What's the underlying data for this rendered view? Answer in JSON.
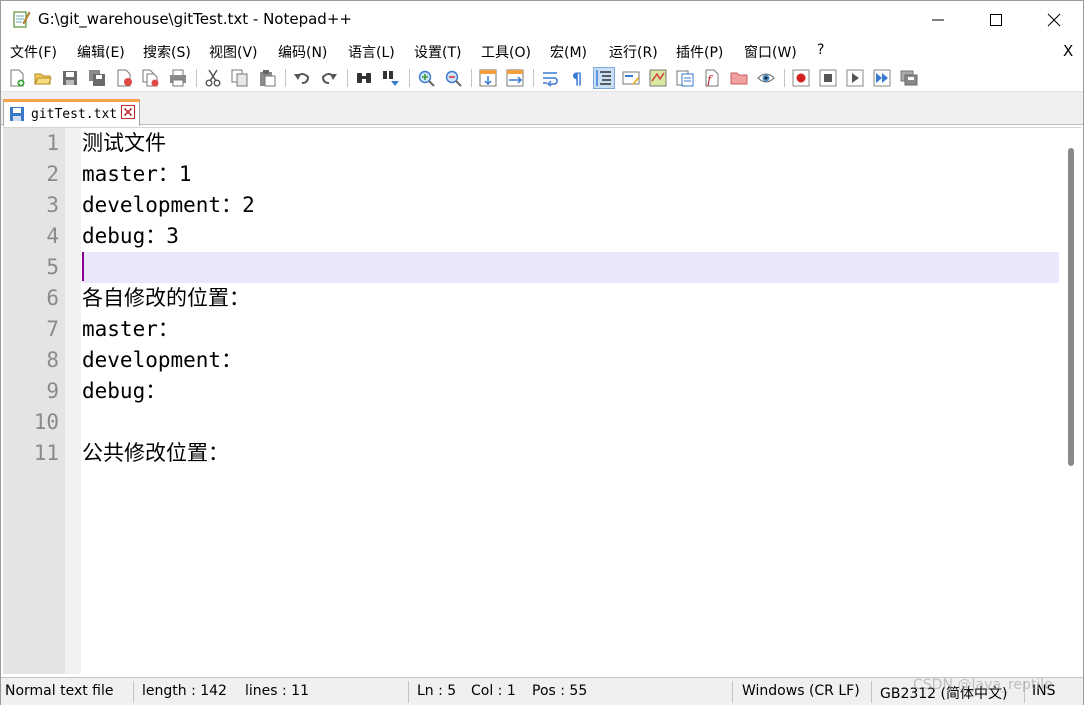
{
  "window": {
    "title": "G:\\git_warehouse\\gitTest.txt - Notepad++"
  },
  "menubar": {
    "items": [
      "文件(F)",
      "编辑(E)",
      "搜索(S)",
      "视图(V)",
      "编码(N)",
      "语言(L)",
      "设置(T)",
      "工具(O)",
      "宏(M)",
      "运行(R)",
      "插件(P)",
      "窗口(W)",
      "?"
    ],
    "close_label": "X"
  },
  "toolbar": {
    "icons": [
      "new-file-icon",
      "open-file-icon",
      "save-icon",
      "save-all-icon",
      "close-icon",
      "close-all-icon",
      "print-icon",
      "cut-icon",
      "copy-icon",
      "paste-icon",
      "undo-icon",
      "redo-icon",
      "find-icon",
      "replace-icon",
      "zoom-in-icon",
      "zoom-out-icon",
      "sync-vertical-icon",
      "sync-horizontal-icon",
      "word-wrap-icon",
      "show-all-chars-icon",
      "indent-guide-icon",
      "user-define-lang-icon",
      "doc-map-icon",
      "function-list-icon",
      "folder-as-workspace-icon",
      "monitoring-icon",
      "record-macro-icon",
      "stop-record-icon",
      "play-macro-icon",
      "run-macro-multiple-icon",
      "save-macro-icon"
    ]
  },
  "tabs": [
    {
      "label": "gitTest.txt"
    }
  ],
  "editor": {
    "lines": [
      {
        "num": "1",
        "text": "测试文件"
      },
      {
        "num": "2",
        "text": "master：1"
      },
      {
        "num": "3",
        "text": "development：2"
      },
      {
        "num": "4",
        "text": "debug：3"
      },
      {
        "num": "5",
        "text": ""
      },
      {
        "num": "6",
        "text": "各自修改的位置："
      },
      {
        "num": "7",
        "text": "master："
      },
      {
        "num": "8",
        "text": "development："
      },
      {
        "num": "9",
        "text": "debug："
      },
      {
        "num": "10",
        "text": ""
      },
      {
        "num": "11",
        "text": "公共修改位置："
      }
    ],
    "current_line": 5
  },
  "statusbar": {
    "file_type": "Normal text file",
    "length": "length : 142",
    "lines": "lines : 11",
    "ln": "Ln : 5",
    "col": "Col : 1",
    "pos": "Pos : 55",
    "eol": "Windows (CR LF)",
    "encoding": "GB2312 (简体中文)",
    "mode": "INS"
  },
  "watermark": "CSDN @Java_reptile",
  "colors": {
    "current_line_bg": "#e8e8fa",
    "caret": "#8b008b",
    "tab_accent": "#f7a44b",
    "gutter_bg": "#e4e4e4",
    "line_number": "#8a8a8a"
  }
}
